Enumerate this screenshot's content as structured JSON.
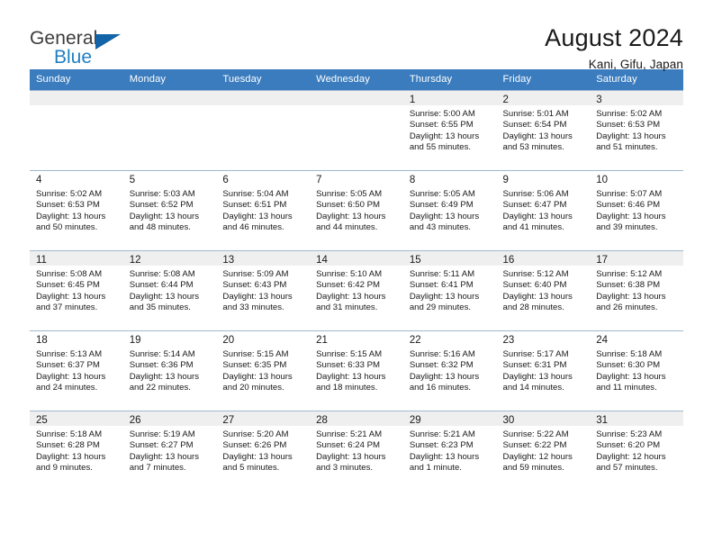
{
  "brand": {
    "name_top": "General",
    "name_bottom": "Blue",
    "color_dark": "#3c3c3c",
    "color_blue": "#1f7fc4",
    "triangle_color": "#1263a8"
  },
  "header": {
    "title": "August 2024",
    "location": "Kani, Gifu, Japan"
  },
  "calendar": {
    "header_bg": "#3a7cbe",
    "header_text_color": "#ffffff",
    "shaded_cell_bg": "#efefef",
    "weekdays": [
      "Sunday",
      "Monday",
      "Tuesday",
      "Wednesday",
      "Thursday",
      "Friday",
      "Saturday"
    ],
    "weeks": [
      [
        {
          "day": "",
          "text": ""
        },
        {
          "day": "",
          "text": ""
        },
        {
          "day": "",
          "text": ""
        },
        {
          "day": "",
          "text": ""
        },
        {
          "day": "1",
          "text": "Sunrise: 5:00 AM\nSunset: 6:55 PM\nDaylight: 13 hours\nand 55 minutes."
        },
        {
          "day": "2",
          "text": "Sunrise: 5:01 AM\nSunset: 6:54 PM\nDaylight: 13 hours\nand 53 minutes."
        },
        {
          "day": "3",
          "text": "Sunrise: 5:02 AM\nSunset: 6:53 PM\nDaylight: 13 hours\nand 51 minutes."
        }
      ],
      [
        {
          "day": "4",
          "text": "Sunrise: 5:02 AM\nSunset: 6:53 PM\nDaylight: 13 hours\nand 50 minutes."
        },
        {
          "day": "5",
          "text": "Sunrise: 5:03 AM\nSunset: 6:52 PM\nDaylight: 13 hours\nand 48 minutes."
        },
        {
          "day": "6",
          "text": "Sunrise: 5:04 AM\nSunset: 6:51 PM\nDaylight: 13 hours\nand 46 minutes."
        },
        {
          "day": "7",
          "text": "Sunrise: 5:05 AM\nSunset: 6:50 PM\nDaylight: 13 hours\nand 44 minutes."
        },
        {
          "day": "8",
          "text": "Sunrise: 5:05 AM\nSunset: 6:49 PM\nDaylight: 13 hours\nand 43 minutes."
        },
        {
          "day": "9",
          "text": "Sunrise: 5:06 AM\nSunset: 6:47 PM\nDaylight: 13 hours\nand 41 minutes."
        },
        {
          "day": "10",
          "text": "Sunrise: 5:07 AM\nSunset: 6:46 PM\nDaylight: 13 hours\nand 39 minutes."
        }
      ],
      [
        {
          "day": "11",
          "text": "Sunrise: 5:08 AM\nSunset: 6:45 PM\nDaylight: 13 hours\nand 37 minutes."
        },
        {
          "day": "12",
          "text": "Sunrise: 5:08 AM\nSunset: 6:44 PM\nDaylight: 13 hours\nand 35 minutes."
        },
        {
          "day": "13",
          "text": "Sunrise: 5:09 AM\nSunset: 6:43 PM\nDaylight: 13 hours\nand 33 minutes."
        },
        {
          "day": "14",
          "text": "Sunrise: 5:10 AM\nSunset: 6:42 PM\nDaylight: 13 hours\nand 31 minutes."
        },
        {
          "day": "15",
          "text": "Sunrise: 5:11 AM\nSunset: 6:41 PM\nDaylight: 13 hours\nand 29 minutes."
        },
        {
          "day": "16",
          "text": "Sunrise: 5:12 AM\nSunset: 6:40 PM\nDaylight: 13 hours\nand 28 minutes."
        },
        {
          "day": "17",
          "text": "Sunrise: 5:12 AM\nSunset: 6:38 PM\nDaylight: 13 hours\nand 26 minutes."
        }
      ],
      [
        {
          "day": "18",
          "text": "Sunrise: 5:13 AM\nSunset: 6:37 PM\nDaylight: 13 hours\nand 24 minutes."
        },
        {
          "day": "19",
          "text": "Sunrise: 5:14 AM\nSunset: 6:36 PM\nDaylight: 13 hours\nand 22 minutes."
        },
        {
          "day": "20",
          "text": "Sunrise: 5:15 AM\nSunset: 6:35 PM\nDaylight: 13 hours\nand 20 minutes."
        },
        {
          "day": "21",
          "text": "Sunrise: 5:15 AM\nSunset: 6:33 PM\nDaylight: 13 hours\nand 18 minutes."
        },
        {
          "day": "22",
          "text": "Sunrise: 5:16 AM\nSunset: 6:32 PM\nDaylight: 13 hours\nand 16 minutes."
        },
        {
          "day": "23",
          "text": "Sunrise: 5:17 AM\nSunset: 6:31 PM\nDaylight: 13 hours\nand 14 minutes."
        },
        {
          "day": "24",
          "text": "Sunrise: 5:18 AM\nSunset: 6:30 PM\nDaylight: 13 hours\nand 11 minutes."
        }
      ],
      [
        {
          "day": "25",
          "text": "Sunrise: 5:18 AM\nSunset: 6:28 PM\nDaylight: 13 hours\nand 9 minutes."
        },
        {
          "day": "26",
          "text": "Sunrise: 5:19 AM\nSunset: 6:27 PM\nDaylight: 13 hours\nand 7 minutes."
        },
        {
          "day": "27",
          "text": "Sunrise: 5:20 AM\nSunset: 6:26 PM\nDaylight: 13 hours\nand 5 minutes."
        },
        {
          "day": "28",
          "text": "Sunrise: 5:21 AM\nSunset: 6:24 PM\nDaylight: 13 hours\nand 3 minutes."
        },
        {
          "day": "29",
          "text": "Sunrise: 5:21 AM\nSunset: 6:23 PM\nDaylight: 13 hours\nand 1 minute."
        },
        {
          "day": "30",
          "text": "Sunrise: 5:22 AM\nSunset: 6:22 PM\nDaylight: 12 hours\nand 59 minutes."
        },
        {
          "day": "31",
          "text": "Sunrise: 5:23 AM\nSunset: 6:20 PM\nDaylight: 12 hours\nand 57 minutes."
        }
      ]
    ]
  }
}
